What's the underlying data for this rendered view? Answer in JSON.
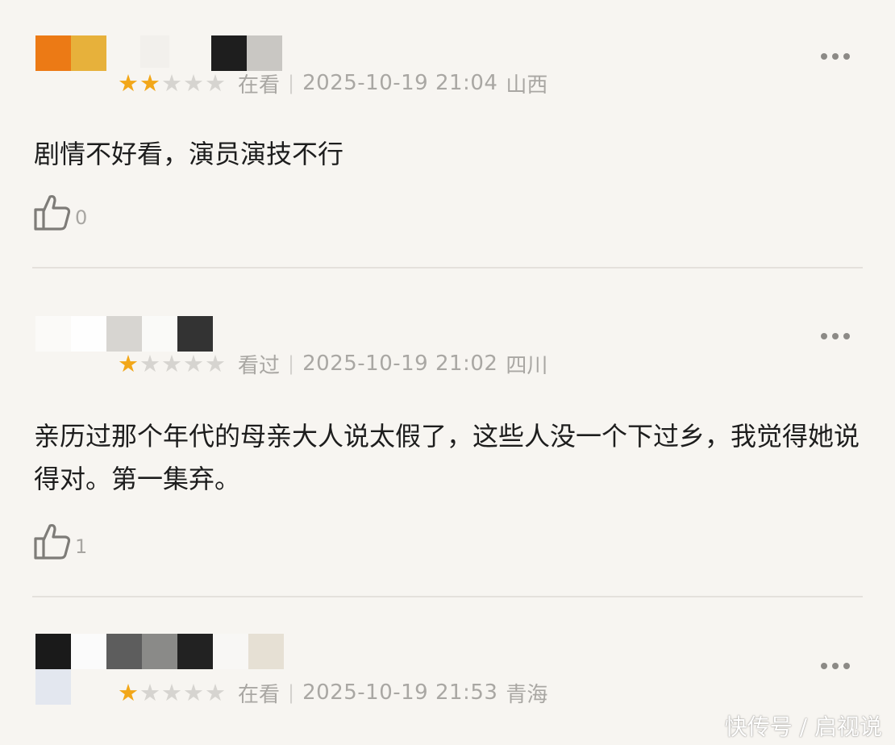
{
  "reviews": [
    {
      "rating": 2,
      "status": "在看",
      "separator": "|",
      "time": "2025-10-19 21:04",
      "region": "山西",
      "text": "剧情不好看，演员演技不行",
      "likes": "0"
    },
    {
      "rating": 1,
      "status": "看过",
      "separator": "|",
      "time": "2025-10-19 21:02",
      "region": "四川",
      "text": "亲历过那个年代的母亲大人说太假了，这些人没一个下过乡，我觉得她说得对。第一集弃。",
      "likes": "1"
    },
    {
      "rating": 1,
      "status": "在看",
      "separator": "|",
      "time": "2025-10-19 21:53",
      "region": "青海",
      "text": "",
      "likes": ""
    }
  ],
  "colors": {
    "star_on": "#f2a719",
    "star_off": "#d6d4d0",
    "background": "#f7f5f1"
  },
  "icons": {
    "star": "star-icon",
    "more": "more-icon",
    "like": "thumbs-up-icon"
  },
  "watermark": "快传号 / 启视说"
}
